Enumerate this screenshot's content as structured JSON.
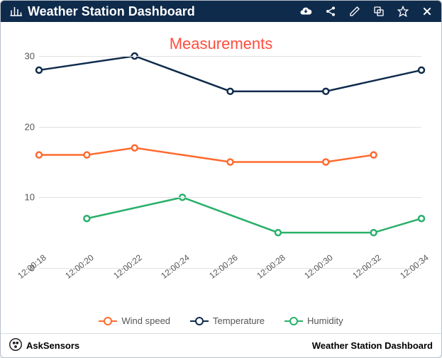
{
  "header": {
    "title": "Weather Station Dashboard",
    "icons": {
      "chart": "chart-bar-icon",
      "cloud": "cloud-download-icon",
      "share": "share-icon",
      "edit": "edit-icon",
      "copy": "copy-icon",
      "star": "star-icon",
      "close": "close-icon"
    }
  },
  "chart_data": {
    "type": "line",
    "title": "Measurements",
    "xlabel": "",
    "ylabel": "",
    "ylim": [
      0,
      30
    ],
    "yticks": [
      0,
      10,
      20,
      30
    ],
    "categories": [
      "12:00:18",
      "12:00:20",
      "12:00:22",
      "12:00:24",
      "12:00:26",
      "12:00:28",
      "12:00:30",
      "12:00:32",
      "12:00:34"
    ],
    "series": [
      {
        "name": "Wind speed",
        "color": "#ff6a2f",
        "values": [
          16,
          16,
          17,
          null,
          15,
          null,
          15,
          16,
          null
        ]
      },
      {
        "name": "Temperature",
        "color": "#0f2b4c",
        "values": [
          28,
          null,
          30,
          null,
          25,
          null,
          25,
          null,
          28
        ]
      },
      {
        "name": "Humidity",
        "color": "#28b06a",
        "values": [
          null,
          7,
          null,
          10,
          null,
          5,
          null,
          5,
          7
        ]
      }
    ],
    "legend_position": "bottom",
    "grid": true
  },
  "footer": {
    "brand": "AskSensors",
    "logo": "asksensors-logo-icon",
    "right": "Weather Station Dashboard"
  }
}
